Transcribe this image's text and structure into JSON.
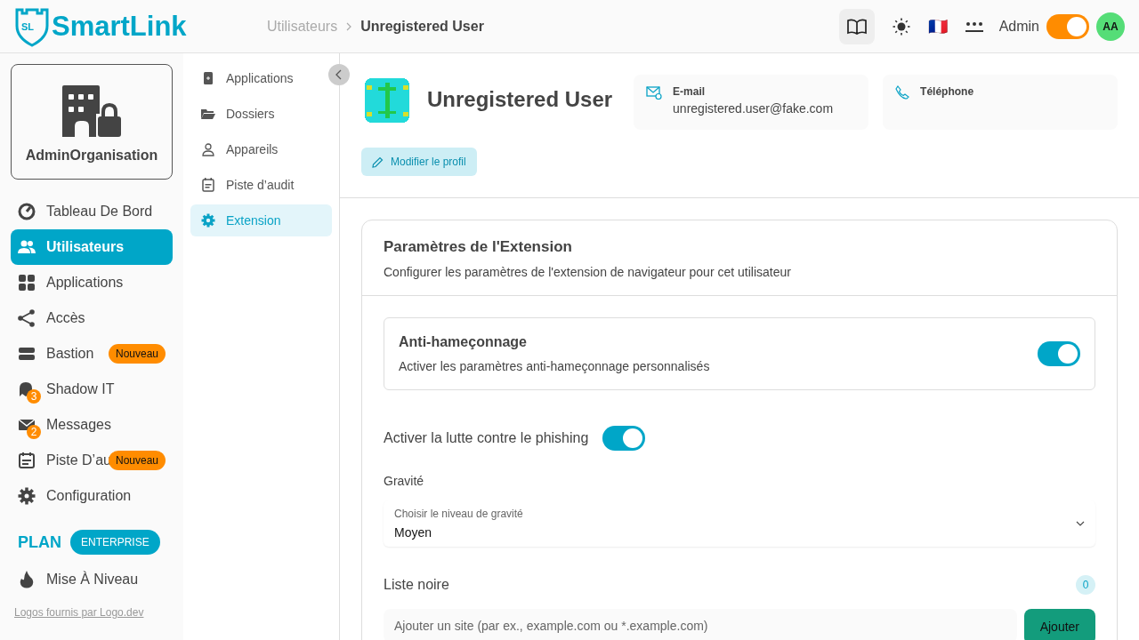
{
  "header": {
    "logo": "SmartLink",
    "logo_badge": "SL",
    "breadcrumb": [
      {
        "label": "Utilisateurs",
        "current": false
      },
      {
        "label": "Unregistered User",
        "current": true
      }
    ],
    "flag": "🇫🇷",
    "user": "Admin",
    "mode_toggle": {
      "on": true
    },
    "avatar": "AA"
  },
  "org": {
    "name": "AdminOrganisation"
  },
  "sidebar": {
    "items": [
      {
        "label": "Tableau De Bord",
        "kind": "gauge",
        "selected": false
      },
      {
        "label": "Utilisateurs",
        "kind": "users",
        "selected": true
      },
      {
        "label": "Applications",
        "kind": "grid",
        "selected": false
      },
      {
        "label": "Accès",
        "kind": "share",
        "selected": false
      },
      {
        "label": "Bastion",
        "kind": "server",
        "selected": false,
        "badge": "Nouveau"
      },
      {
        "label": "Shadow IT",
        "kind": "ghost",
        "selected": false,
        "count": "3"
      },
      {
        "label": "Messages",
        "kind": "mail",
        "selected": false,
        "count": "2"
      },
      {
        "label": "Piste D’au",
        "kind": "calendar",
        "selected": false,
        "badge": "Nouveau"
      },
      {
        "label": "Configuration",
        "kind": "gear",
        "selected": false
      }
    ],
    "plan_label": "PLAN",
    "plan": "ENTERPRISE",
    "upgrade": "Mise À Niveau",
    "footer_link": "Logos fournis par Logo.dev"
  },
  "subnav": {
    "items": [
      {
        "label": "Applications",
        "kind": "app",
        "selected": false
      },
      {
        "label": "Dossiers",
        "kind": "folder",
        "selected": false
      },
      {
        "label": "Appareils",
        "kind": "person",
        "selected": false
      },
      {
        "label": "Piste d’audit",
        "kind": "calendar",
        "selected": false
      },
      {
        "label": "Extension",
        "kind": "gear",
        "selected": true
      }
    ]
  },
  "profile": {
    "name": "Unregistered User",
    "edit_button": "Modifier le profil",
    "email_label": "E-mail",
    "email": "unregistered.user@fake.com",
    "phone_label": "Téléphone"
  },
  "settings": {
    "title": "Paramètres de l'Extension",
    "subtitle": "Configurer les paramètres de l'extension de navigateur pour cet utilisateur",
    "anti": {
      "title": "Anti-hameçonnage",
      "description": "Activer les paramètres anti-hameçonnage personnalisés",
      "on": true
    },
    "phishing": {
      "label": "Activer la lutte contre le phishing",
      "on": true
    },
    "severity_label": "Gravité",
    "severity": {
      "placeholder": "Choisir le niveau de gravité",
      "value": "Moyen"
    },
    "blacklist_label": "Liste noire",
    "blacklist_count": "0",
    "site_input": {
      "placeholder": "Ajouter un site (par ex., example.com ou *.example.com)"
    },
    "add_button": "Ajouter"
  }
}
